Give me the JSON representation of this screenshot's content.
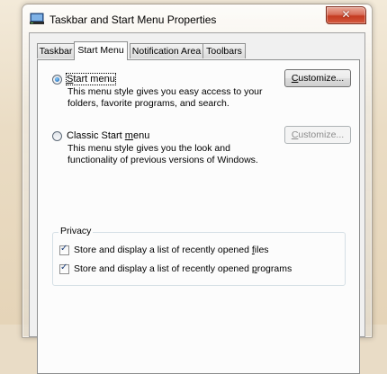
{
  "window": {
    "title": "Taskbar and Start Menu Properties"
  },
  "tabs": [
    {
      "label": "Taskbar",
      "active": false
    },
    {
      "label": "Start Menu",
      "active": true
    },
    {
      "label": "Notification Area",
      "active": false
    },
    {
      "label": "Toolbars",
      "active": false
    }
  ],
  "options": {
    "start_menu": {
      "label_prefix": "",
      "label_mnemonic": "S",
      "label_rest": "tart menu",
      "selected": true,
      "description_line1": "This menu style gives you easy access to your",
      "description_line2": "folders, favorite programs, and search.",
      "button_mnemonic": "C",
      "button_rest": "ustomize..."
    },
    "classic_start_menu": {
      "label_prefix": "Classic Start ",
      "label_mnemonic": "m",
      "label_rest": "enu",
      "selected": false,
      "description_line1": "This menu style gives you the look and",
      "description_line2": "functionality of previous versions of Windows.",
      "button_mnemonic": "C",
      "button_rest": "ustomize...",
      "button_enabled": false
    }
  },
  "privacy": {
    "legend": "Privacy",
    "items": [
      {
        "prefix": "Store and display a list of recently opened ",
        "mnemonic": "f",
        "rest": "iles",
        "checked": true
      },
      {
        "prefix": "Store and display a list of recently opened ",
        "mnemonic": "p",
        "rest": "rograms",
        "checked": true
      }
    ]
  },
  "icons": {
    "title_icon": "taskbar-properties-icon",
    "close": "close-icon",
    "check": "checkmark-icon"
  },
  "colors": {
    "close_button": "#c43b21",
    "radio_dot": "#2a75c0",
    "panel_bg": "#fcfcfc"
  }
}
